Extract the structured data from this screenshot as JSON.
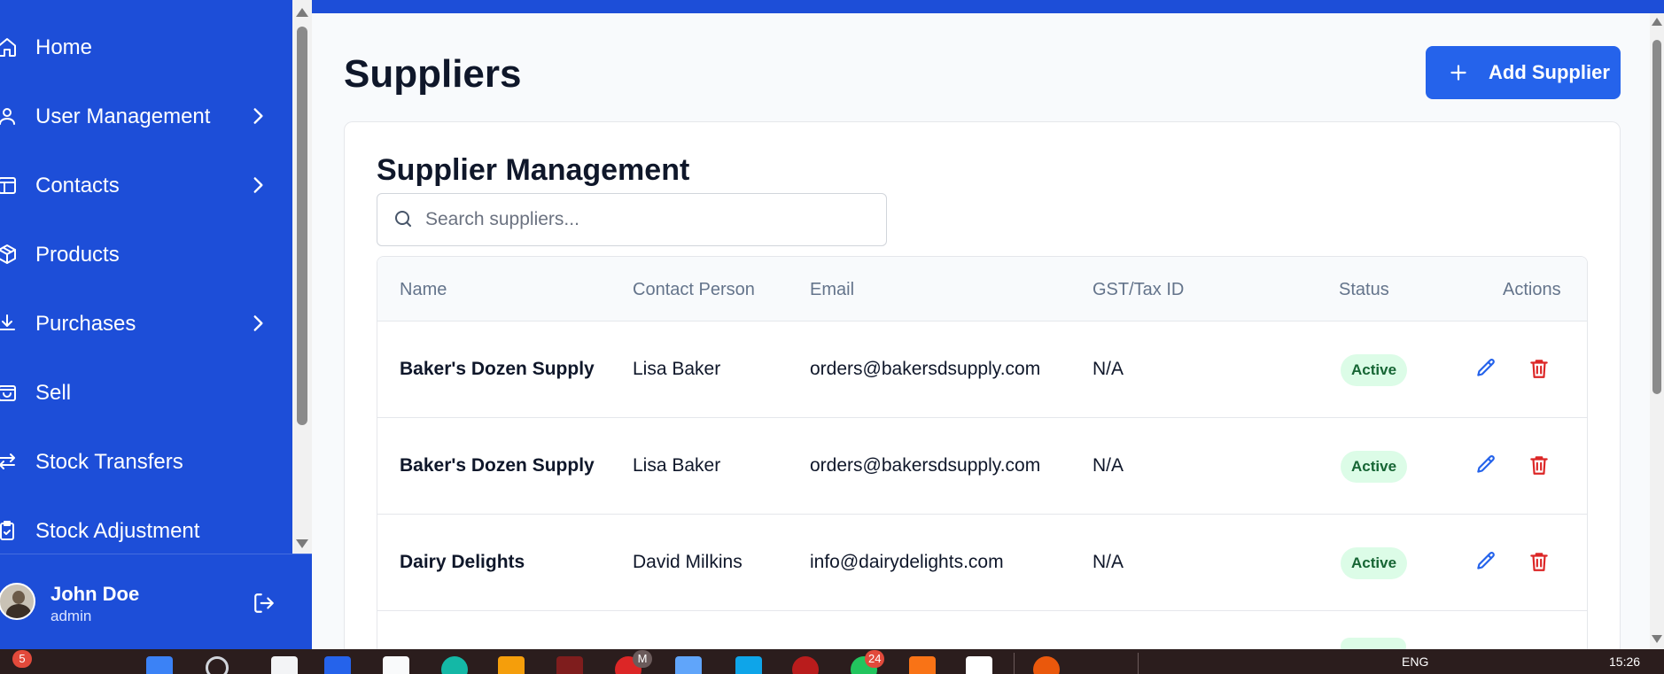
{
  "sidebar": {
    "items": [
      {
        "label": "Home",
        "icon": "home-icon",
        "has_children": false
      },
      {
        "label": "User Management",
        "icon": "user-icon",
        "has_children": true
      },
      {
        "label": "Contacts",
        "icon": "contacts-icon",
        "has_children": true
      },
      {
        "label": "Products",
        "icon": "package-icon",
        "has_children": false
      },
      {
        "label": "Purchases",
        "icon": "download-icon",
        "has_children": true
      },
      {
        "label": "Sell",
        "icon": "shopping-bag-icon",
        "has_children": false
      },
      {
        "label": "Stock Transfers",
        "icon": "arrows-left-right-icon",
        "has_children": false
      },
      {
        "label": "Stock Adjustment",
        "icon": "clipboard-check-icon",
        "has_children": false
      }
    ],
    "user": {
      "name": "John Doe",
      "role": "admin"
    }
  },
  "page": {
    "title": "Suppliers",
    "add_button": "Add Supplier"
  },
  "card": {
    "title": "Supplier Management",
    "search_placeholder": "Search suppliers...",
    "columns": [
      "Name",
      "Contact Person",
      "Email",
      "GST/Tax ID",
      "Status",
      "Actions"
    ],
    "rows": [
      {
        "name": "Baker's Dozen Supply",
        "contact": "Lisa Baker",
        "email": "orders@bakersdsupply.com",
        "tax_id": "N/A",
        "status": "Active"
      },
      {
        "name": "Baker's Dozen Supply",
        "contact": "Lisa Baker",
        "email": "orders@bakersdsupply.com",
        "tax_id": "N/A",
        "status": "Active"
      },
      {
        "name": "Dairy Delights",
        "contact": "David Milkins",
        "email": "info@dairydelights.com",
        "tax_id": "N/A",
        "status": "Active"
      }
    ]
  },
  "taskbar": {
    "notification_count": "5",
    "badge_m": "M",
    "badge_24": "24",
    "language": "ENG",
    "time": "15:26"
  },
  "colors": {
    "brand": "#1d4ed8",
    "primary_button": "#2563eb",
    "status_active_bg": "#dcfce7",
    "status_active_text": "#166534",
    "delete": "#dc2626"
  }
}
